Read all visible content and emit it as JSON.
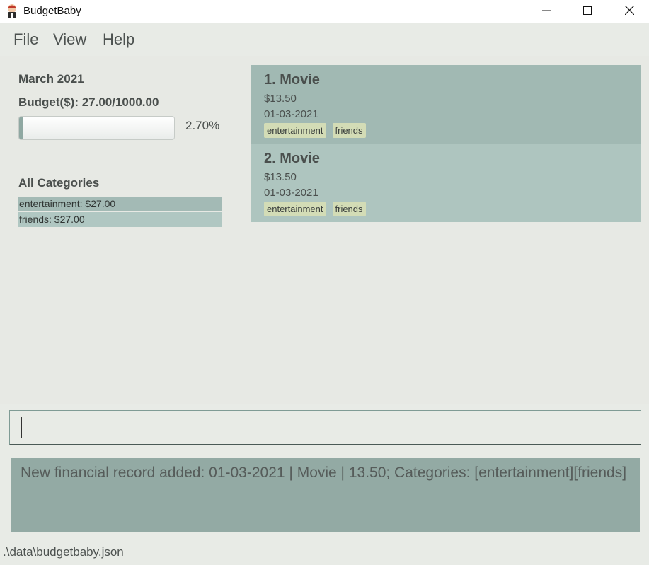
{
  "window": {
    "title": "BudgetBaby"
  },
  "menu": {
    "items": [
      "File",
      "View",
      "Help"
    ]
  },
  "budget": {
    "month": "March 2021",
    "summary": "Budget($): 27.00/1000.00",
    "percent_label": "2.70%",
    "progress_fraction": 0.027
  },
  "categories": {
    "title": "All Categories",
    "items": [
      "entertainment: $27.00",
      "friends: $27.00"
    ]
  },
  "records": [
    {
      "title": "1.  Movie",
      "amount": "$13.50",
      "date": "01-03-2021",
      "tags": [
        "entertainment",
        "friends"
      ]
    },
    {
      "title": "2.  Movie",
      "amount": "$13.50",
      "date": "01-03-2021",
      "tags": [
        "entertainment",
        "friends"
      ]
    }
  ],
  "command": {
    "value": ""
  },
  "result": {
    "message": "New financial record added: 01-03-2021 | Movie | 13.50; Categories: [entertainment][friends]"
  },
  "status": {
    "path": ".\\data\\budgetbaby.json"
  },
  "colors": {
    "accent": "#93aaa4",
    "card_odd": "#a1b9b3",
    "card_even": "#aec5bf",
    "tag": "#d3dcb6"
  },
  "icons": {
    "app": "baby-icon",
    "minimize": "minimize-icon",
    "maximize": "maximize-icon",
    "close": "close-icon"
  }
}
